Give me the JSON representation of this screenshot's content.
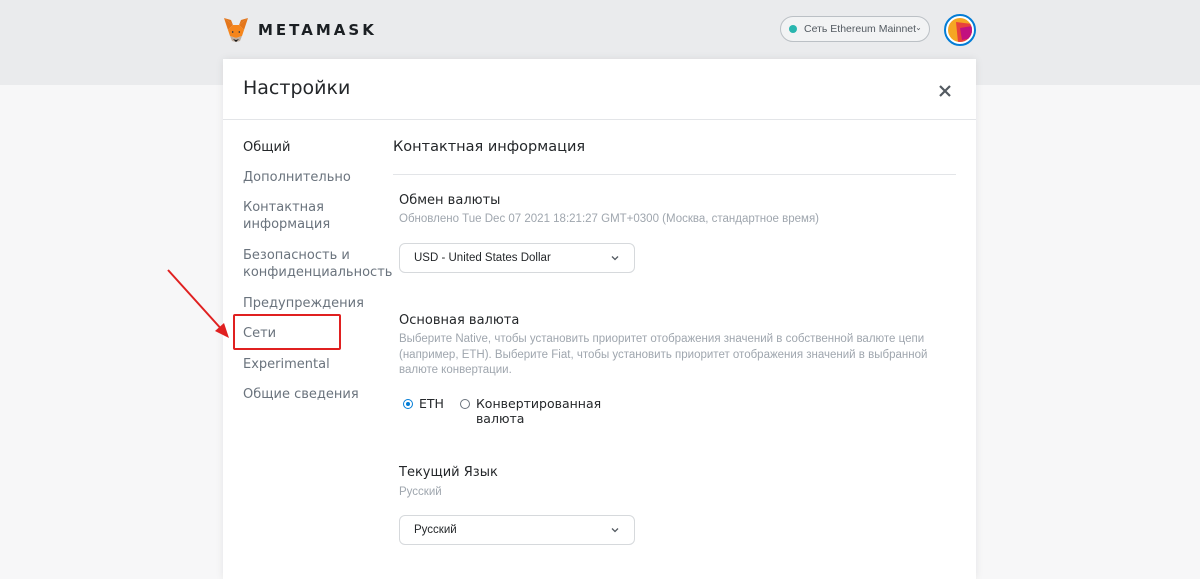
{
  "header": {
    "brand": "METAMASK",
    "network": {
      "label": "Сеть Ethereum Mainnet",
      "dot_color": "#29b6af"
    },
    "avatar_colors": [
      "#f5a623",
      "#e8413c",
      "#c2117f"
    ]
  },
  "settings": {
    "title": "Настройки",
    "close_icon": "close-icon",
    "sidebar": [
      {
        "label": "Общий",
        "active": true
      },
      {
        "label": "Дополнительно"
      },
      {
        "label": "Контактная информация"
      },
      {
        "label": "Безопасность и конфиденциальность"
      },
      {
        "label": "Предупреждения"
      },
      {
        "label": "Сети",
        "highlighted": true
      },
      {
        "label": "Experimental"
      },
      {
        "label": "Общие сведения"
      }
    ],
    "section_title": "Контактная информация",
    "currency": {
      "label": "Обмен валюты",
      "updated": "Обновлено Tue Dec 07 2021 18:21:27 GMT+0300 (Москва, стандартное время)",
      "selected": "USD - United States Dollar"
    },
    "primary": {
      "label": "Основная валюта",
      "description": "Выберите Native, чтобы установить приоритет отображения значений в собственной валюте цепи (например, ETH). Выберите Fiat, чтобы установить приоритет отображения значений в выбранной валюте конвертации.",
      "options": [
        {
          "label": "ETH",
          "checked": true
        },
        {
          "label": "Конвертированная валюта",
          "checked": false
        }
      ]
    },
    "language": {
      "label": "Текущий Язык",
      "current": "Русский",
      "selected": "Русский"
    }
  },
  "colors": {
    "accent": "#037dd6",
    "annotation": "#e02020"
  }
}
